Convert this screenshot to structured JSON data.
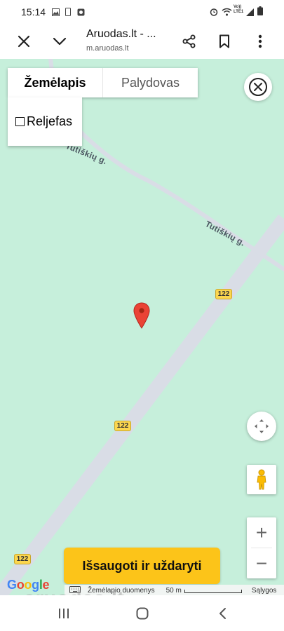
{
  "status_bar": {
    "time": "15:14",
    "network_label_top": "Vo))",
    "network_label_bottom": "LTE1",
    "icons": [
      "gallery-icon",
      "phone-icon",
      "camera-icon",
      "alarm-icon",
      "wifi-icon",
      "signal-icon",
      "battery-icon"
    ]
  },
  "browser": {
    "title": "Aruodas.lt - ...",
    "url": "m.aruodas.lt",
    "icons": [
      "close-icon",
      "chevron-down-icon",
      "share-icon",
      "bookmark-icon",
      "more-vert-icon"
    ]
  },
  "map": {
    "type_tabs": [
      {
        "label": "Žemėlapis",
        "selected": true
      },
      {
        "label": "Palydovas",
        "selected": false
      }
    ],
    "terrain_label": "Reljefas",
    "terrain_checked": false,
    "street_labels": [
      "Tutiškių g.",
      "Tutiškių g."
    ],
    "route_shields": [
      "122",
      "122",
      "122"
    ],
    "save_button": "Išsaugoti ir uždaryti",
    "google_logo": [
      "G",
      "o",
      "o",
      "g",
      "l",
      "e"
    ],
    "attribution": "Žemėlapio duomenys",
    "scale": "50 m",
    "terms": "Sąlygos",
    "zoom_in": "+",
    "zoom_out": "−",
    "colors": {
      "land": "#c6efdb",
      "road": "#d9dde6",
      "shield": "#fbd64f",
      "button": "#fcc419",
      "marker": "#ea4335"
    }
  },
  "watermark": "aruodas.lt",
  "nav": {
    "icons": [
      "recent-apps-icon",
      "home-icon",
      "back-icon"
    ]
  }
}
